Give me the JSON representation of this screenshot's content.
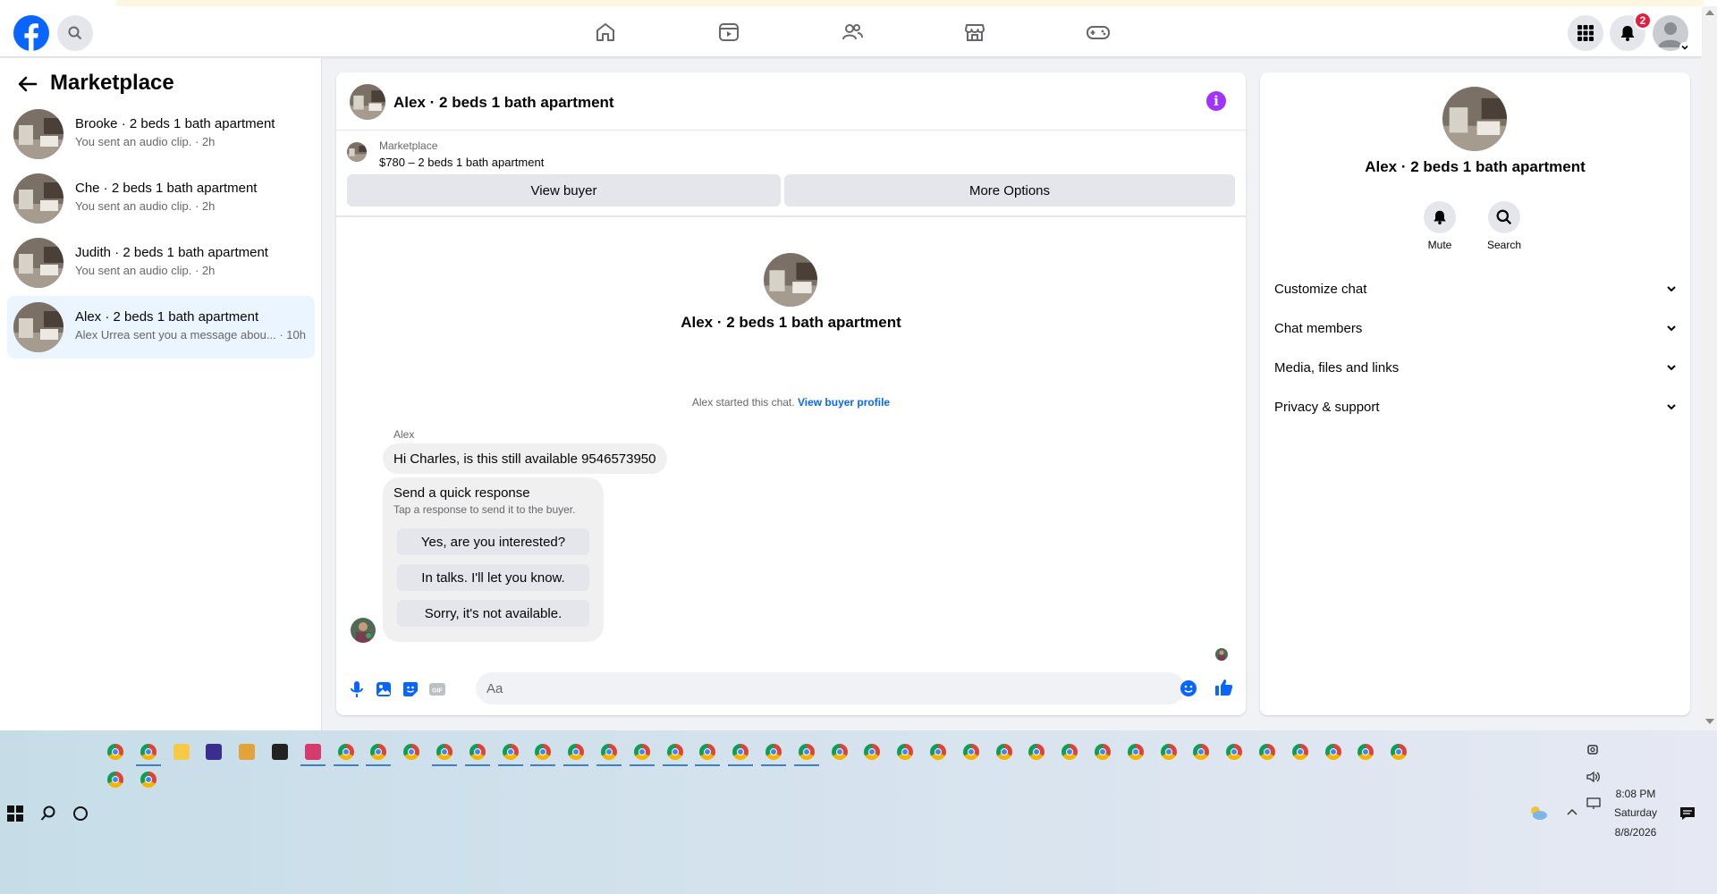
{
  "header": {
    "notification_count": "2",
    "search_label": "Search Facebook"
  },
  "sidebar": {
    "title": "Marketplace",
    "conversations": [
      {
        "name": "Brooke · 2 beds 1 bath apartment",
        "snippet": "You sent an audio clip. · 2h"
      },
      {
        "name": "Che · 2 beds 1 bath apartment",
        "snippet": "You sent an audio clip. · 2h"
      },
      {
        "name": "Judith · 2 beds 1 bath apartment",
        "snippet": "You sent an audio clip. · 2h"
      },
      {
        "name": "Alex · 2 beds 1 bath apartment",
        "snippet": "Alex Urrea sent you a message abou... · 10h"
      }
    ]
  },
  "chat": {
    "title": "Alex · 2 beds 1 bath apartment",
    "listing_source": "Marketplace",
    "listing_title": "$780 – 2 beds 1 bath apartment",
    "view_buyer": "View buyer",
    "more_options": "More Options",
    "profile_name": "Alex · 2 beds 1 bath apartment",
    "started_text": "Alex started this chat.",
    "view_profile_link": "View buyer profile",
    "sender_name": "Alex",
    "message": "Hi Charles, is this still available 9546573950",
    "quick_title": "Send a quick response",
    "quick_subtitle": "Tap a response to send it to the buyer.",
    "quick_responses": [
      "Yes, are you interested?",
      "In talks. I'll let you know.",
      "Sorry, it's not available."
    ],
    "composer_placeholder": "Aa"
  },
  "details": {
    "title": "Alex · 2 beds 1 bath apartment",
    "actions": [
      {
        "label": "Mute",
        "icon": "bell-icon"
      },
      {
        "label": "Search",
        "icon": "search-icon"
      }
    ],
    "sections": [
      "Customize chat",
      "Chat members",
      "Media, files and links",
      "Privacy & support"
    ]
  },
  "taskbar": {
    "time": "8:08 PM",
    "day": "Saturday",
    "date": "8/8/2026"
  },
  "colors": {
    "brand": "#0866ff",
    "accent_purple": "#a033ff",
    "badge": "#e41e3f"
  }
}
